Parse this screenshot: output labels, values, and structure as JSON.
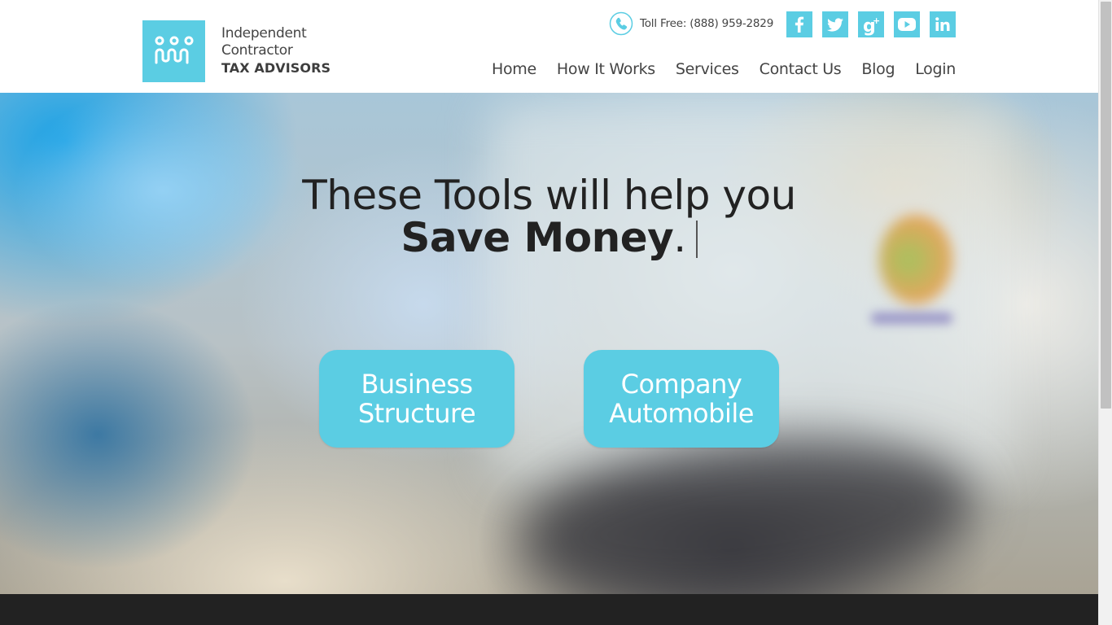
{
  "brand": {
    "line1": "Independent",
    "line2": "Contractor",
    "line3": "TAX ADVISORS",
    "color": "#5bcde3"
  },
  "phone": {
    "icon": "phone-icon",
    "text": "Toll Free: (888) 959-2829"
  },
  "social": [
    {
      "icon": "facebook-icon"
    },
    {
      "icon": "twitter-icon"
    },
    {
      "icon": "google-plus-icon"
    },
    {
      "icon": "youtube-icon"
    },
    {
      "icon": "linkedin-icon"
    }
  ],
  "nav": {
    "items": [
      "Home",
      "How It Works",
      "Services",
      "Contact Us",
      "Blog",
      "Login"
    ]
  },
  "hero": {
    "line1": "These Tools will help you",
    "line2_strong": "Save Money",
    "line2_suffix": ".",
    "buttons": [
      {
        "line1": "Business",
        "line2": "Structure"
      },
      {
        "line1": "Company",
        "line2": "Automobile"
      }
    ]
  },
  "colors": {
    "accent": "#5bcde3",
    "footer": "#222222",
    "text": "#444444"
  }
}
